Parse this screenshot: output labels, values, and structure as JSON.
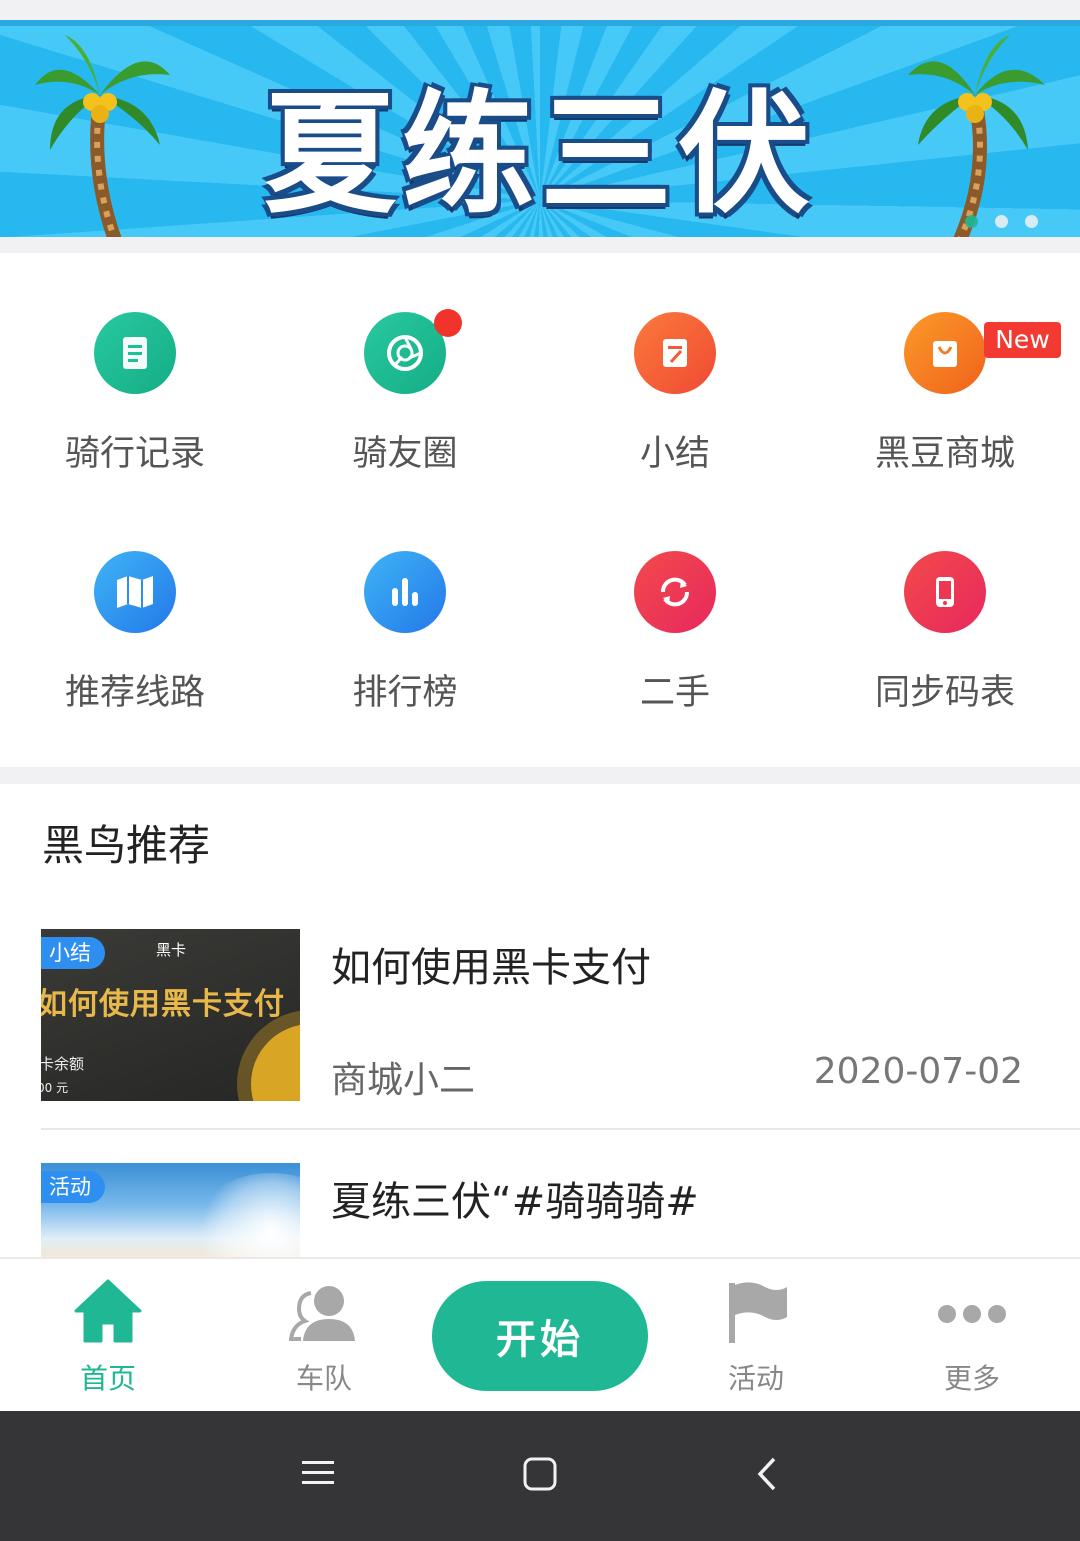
{
  "banner": {
    "title": "夏练三伏",
    "slides": 3,
    "active_slide": 1
  },
  "features": [
    {
      "label": "骑行记录",
      "icon": "document-icon",
      "color": "#1dbf94"
    },
    {
      "label": "骑友圈",
      "icon": "camera-lens-icon",
      "color": "#1dbf94",
      "badge_dot": true
    },
    {
      "label": "小结",
      "icon": "note-edit-icon",
      "color": "#f45a36"
    },
    {
      "label": "黑豆商城",
      "icon": "shopping-bag-icon",
      "color": "#f37b22",
      "badge": "New"
    },
    {
      "label": "推荐线路",
      "icon": "map-icon",
      "color": "#2f8ff0"
    },
    {
      "label": "排行榜",
      "icon": "bar-chart-icon",
      "color": "#2f8ff0"
    },
    {
      "label": "二手",
      "icon": "refresh-icon",
      "color": "#ee3552"
    },
    {
      "label": "同步码表",
      "icon": "phone-icon",
      "color": "#ee3552"
    }
  ],
  "recommend": {
    "section_title": "黑鸟推荐",
    "articles": [
      {
        "tag": "小结",
        "thumb_caption_small": "黑卡",
        "thumb_caption": "如何使用黑卡支付",
        "thumb_balance_label": "卡余额",
        "thumb_balance_value": "00 元",
        "title": "如何使用黑卡支付",
        "author": "商城小二",
        "date": "2020-07-02"
      },
      {
        "tag": "活动",
        "title": "夏练三伏“#骑骑骑#"
      }
    ]
  },
  "tabbar": {
    "home": "首页",
    "team": "车队",
    "start": "开始",
    "activity": "活动",
    "more": "更多",
    "accent": "#1fb794"
  }
}
